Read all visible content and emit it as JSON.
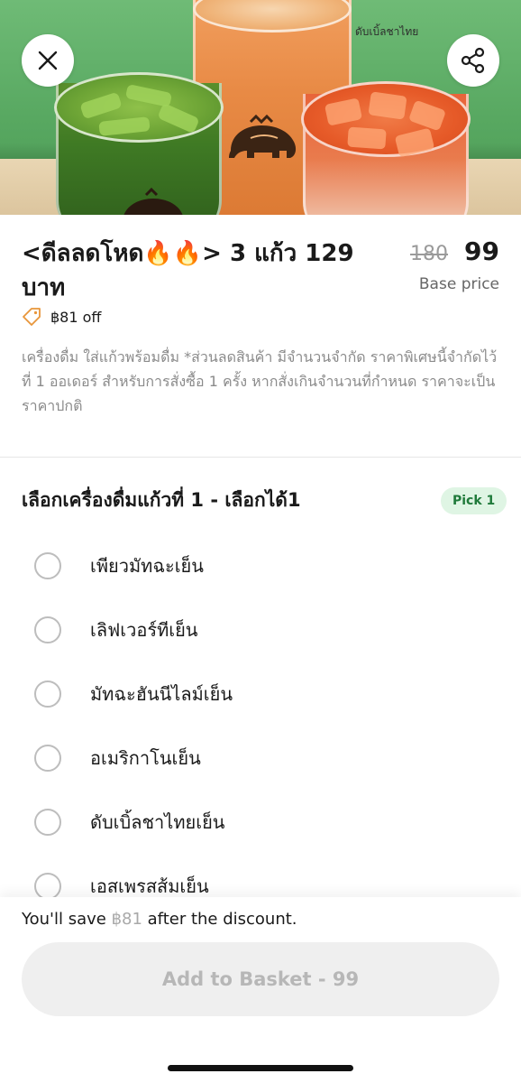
{
  "hero": {
    "brand_text": "ดับเบิ้ลชาไทย"
  },
  "product": {
    "title": "<ดีลลดโหด🔥🔥> 3 แก้ว 129 บาท",
    "old_price": "180",
    "price": "99",
    "base_price_label": "Base price",
    "discount_text": "฿81 off",
    "description": "เครื่องดื่ม ใส่แก้วพร้อมดื่ม  *ส่วนลดสินค้า มีจำนวนจำกัด ราคาพิเศษนี้จำกัดไว้ที่ 1 ออเดอร์ สำหรับการสั่งซื้อ 1 ครั้ง หากสั่งเกินจำนวนที่กำหนด ราคาจะเป็นราคาปกติ"
  },
  "option_group": {
    "title": "เลือกเครื่องดื่มแก้วที่ 1 - เลือกได้1",
    "badge": "Pick 1",
    "options": [
      {
        "label": "เพียวมัทฉะเย็น"
      },
      {
        "label": "เลิฟเวอร์ทีเย็น"
      },
      {
        "label": "มัทฉะฮันนีไลม์เย็น"
      },
      {
        "label": "อเมริกาโนเย็น"
      },
      {
        "label": "ดับเบิ้ลชาไทยเย็น"
      },
      {
        "label": "เอสเพรสส้มเย็น"
      }
    ]
  },
  "footer": {
    "save_prefix": "You'll save ",
    "save_amount": "฿81",
    "save_suffix": " after the discount.",
    "cta_label": "Add to Basket - 99"
  },
  "colors": {
    "accent_green": "#1f7a3a",
    "badge_bg": "#dff5e4",
    "tag_orange": "#e8963a",
    "cta_bg": "#efefef"
  },
  "icons": [
    "close-icon",
    "share-icon",
    "price-tag-icon",
    "radio-unselected-icon"
  ]
}
